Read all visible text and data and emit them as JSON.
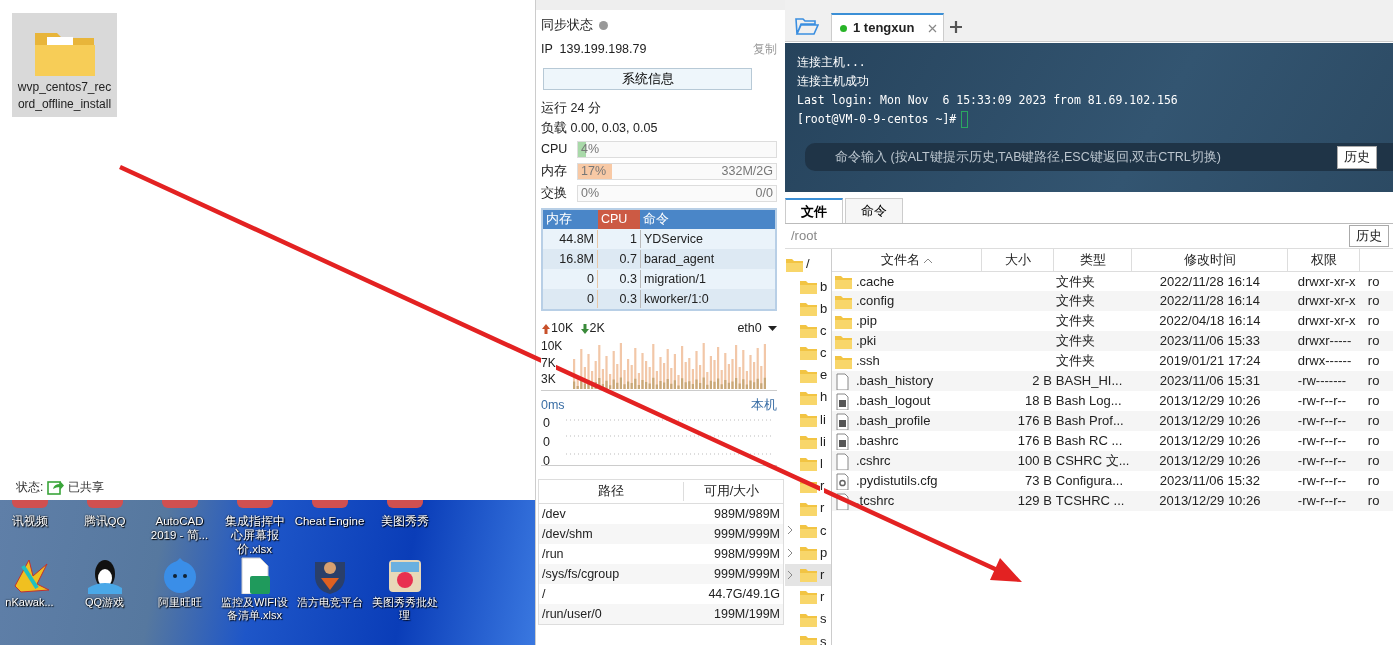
{
  "explorer_window": {
    "folder": {
      "label": "wvp_centos7_record_offline_install",
      "selected": true
    },
    "status_label": "状态:",
    "status_value": "已共享"
  },
  "desktop_icons_top": [
    {
      "label": "讯视频"
    },
    {
      "label": "腾讯QQ"
    },
    {
      "label": "AutoCAD 2019 - 简..."
    },
    {
      "label": "集成指挥中心屏幕报价.xlsx"
    },
    {
      "label": "Cheat Engine"
    },
    {
      "label": "美图秀秀"
    }
  ],
  "desktop_icons_bottom": [
    {
      "label": "nKawak...",
      "kind": "game"
    },
    {
      "label": "QQ游戏",
      "kind": "penguin"
    },
    {
      "label": "阿里旺旺",
      "kind": "chat"
    },
    {
      "label": "监控及WIFI设备清单.xlsx",
      "kind": "sheet"
    },
    {
      "label": "浩方电竞平台",
      "kind": "shield"
    },
    {
      "label": "美图秀秀批处理",
      "kind": "photo"
    }
  ],
  "server_panel": {
    "sync_label": "同步状态",
    "synced": false,
    "ip_label": "IP",
    "ip": "139.199.198.79",
    "copy": "复制",
    "sysinfo_button": "系统信息",
    "uptime": "运行 24 分",
    "load": "负载 0.00, 0.03, 0.05",
    "meters": [
      {
        "label": "CPU",
        "value": "4%",
        "level": 0.04,
        "kind": "cpu"
      },
      {
        "label": "内存",
        "value": "17%",
        "detail": "332M/2G",
        "level": 0.17,
        "kind": "mem"
      },
      {
        "label": "交换",
        "value": "0%",
        "detail": "0/0",
        "level": 0,
        "kind": "swap"
      }
    ],
    "process_columns": [
      "内存",
      "CPU",
      "命令"
    ],
    "processes": [
      {
        "mem": "44.8M",
        "cpu": "1",
        "cmd": "YDService"
      },
      {
        "mem": "16.8M",
        "cpu": "0.7",
        "cmd": "barad_agent"
      },
      {
        "mem": "0",
        "cpu": "0.3",
        "cmd": "migration/1"
      },
      {
        "mem": "0",
        "cpu": "0.3",
        "cmd": "kworker/1:0"
      }
    ],
    "net_up": "10K",
    "net_down": "2K",
    "interface": "eth0",
    "net_ticks": [
      "10K",
      "7K",
      "3K"
    ],
    "latency": "0ms",
    "latency_host": "本机",
    "latency_ticks": [
      "0",
      "0",
      "0"
    ],
    "disk_columns": [
      "路径",
      "可用/大小"
    ],
    "disks": [
      {
        "path": "/dev",
        "usage": "989M/989M"
      },
      {
        "path": "/dev/shm",
        "usage": "999M/999M"
      },
      {
        "path": "/run",
        "usage": "998M/999M"
      },
      {
        "path": "/sys/fs/cgroup",
        "usage": "999M/999M"
      },
      {
        "path": "/",
        "usage": "44.7G/49.1G"
      },
      {
        "path": "/run/user/0",
        "usage": "199M/199M"
      }
    ]
  },
  "session_tabs": [
    {
      "label": "1 tengxun",
      "selected": true,
      "connected": true
    }
  ],
  "terminal": {
    "lines": [
      "连接主机...",
      "连接主机成功",
      "Last login: Mon Nov  6 15:33:09 2023 from 81.69.102.156",
      "[root@VM-0-9-centos ~]#"
    ],
    "command_placeholder": "命令输入 (按ALT键提示历史,TAB键路径,ESC键返回,双击CTRL切换)",
    "history_button": "历史"
  },
  "bottom_tabs": [
    {
      "label": "文件",
      "selected": true
    },
    {
      "label": "命令",
      "selected": false
    }
  ],
  "path_bar": {
    "value": "/root",
    "history_button": "历史"
  },
  "tree": [
    {
      "label": "/",
      "collapsed": false,
      "selected": false,
      "children": [
        {
          "label": "b",
          "collapsed": false,
          "selected": false
        },
        {
          "label": "b",
          "collapsed": false,
          "selected": false
        },
        {
          "label": "c",
          "collapsed": false,
          "selected": false
        },
        {
          "label": "c",
          "collapsed": false,
          "selected": false
        },
        {
          "label": "e",
          "collapsed": false,
          "selected": false
        },
        {
          "label": "h",
          "collapsed": false,
          "selected": false
        },
        {
          "label": "li",
          "collapsed": false,
          "selected": false
        },
        {
          "label": "li",
          "collapsed": false,
          "selected": false
        },
        {
          "label": "l",
          "collapsed": false,
          "selected": false
        },
        {
          "label": "r",
          "collapsed": false,
          "selected": false
        },
        {
          "label": "r",
          "collapsed": false,
          "selected": false
        },
        {
          "label": "c",
          "collapsed": true,
          "selected": false
        },
        {
          "label": "p",
          "collapsed": true,
          "selected": false
        },
        {
          "label": "r",
          "collapsed": true,
          "selected": true
        },
        {
          "label": "r",
          "collapsed": false,
          "selected": false
        },
        {
          "label": "s",
          "collapsed": false,
          "selected": false
        },
        {
          "label": "s",
          "collapsed": false,
          "selected": false
        }
      ]
    }
  ],
  "file_table": {
    "columns": [
      {
        "label": "文件名",
        "sorted": true
      },
      {
        "label": "大小",
        "sorted": false
      },
      {
        "label": "类型",
        "sorted": false
      },
      {
        "label": "修改时间",
        "sorted": false
      },
      {
        "label": "权限",
        "sorted": false
      }
    ],
    "rows": [
      {
        "kind": "folder",
        "name": ".cache",
        "size": "",
        "type": "文件夹",
        "modified": "2022/11/28 16:14",
        "perms": "drwxr-xr-x",
        "column_6": "ro"
      },
      {
        "kind": "folder",
        "name": ".config",
        "size": "",
        "type": "文件夹",
        "modified": "2022/11/28 16:14",
        "perms": "drwxr-xr-x",
        "column_6": "ro"
      },
      {
        "kind": "folder",
        "name": ".pip",
        "size": "",
        "type": "文件夹",
        "modified": "2022/04/18 16:14",
        "perms": "drwxr-xr-x",
        "column_6": "ro"
      },
      {
        "kind": "folder",
        "name": ".pki",
        "size": "",
        "type": "文件夹",
        "modified": "2023/11/06 15:33",
        "perms": "drwxr-----",
        "column_6": "ro"
      },
      {
        "kind": "folder",
        "name": ".ssh",
        "size": "",
        "type": "文件夹",
        "modified": "2019/01/21 17:24",
        "perms": "drwx------",
        "column_6": "ro"
      },
      {
        "kind": "file",
        "name": ".bash_history",
        "size": "2 B",
        "type": "BASH_HI...",
        "modified": "2023/11/06 15:31",
        "perms": "-rw-------",
        "column_6": "ro"
      },
      {
        "kind": "script",
        "name": ".bash_logout",
        "size": "18 B",
        "type": "Bash Log...",
        "modified": "2013/12/29 10:26",
        "perms": "-rw-r--r--",
        "column_6": "ro"
      },
      {
        "kind": "script",
        "name": ".bash_profile",
        "size": "176 B",
        "type": "Bash Prof...",
        "modified": "2013/12/29 10:26",
        "perms": "-rw-r--r--",
        "column_6": "ro"
      },
      {
        "kind": "script",
        "name": ".bashrc",
        "size": "176 B",
        "type": "Bash RC ...",
        "modified": "2013/12/29 10:26",
        "perms": "-rw-r--r--",
        "column_6": "ro"
      },
      {
        "kind": "file",
        "name": ".cshrc",
        "size": "100 B",
        "type": "CSHRC 文...",
        "modified": "2013/12/29 10:26",
        "perms": "-rw-r--r--",
        "column_6": "ro"
      },
      {
        "kind": "config",
        "name": ".pydistutils.cfg",
        "size": "73 B",
        "type": "Configura...",
        "modified": "2023/11/06 15:32",
        "perms": "-rw-r--r--",
        "column_6": "ro"
      },
      {
        "kind": "file",
        "name": ".tcshrc",
        "size": "129 B",
        "type": "TCSHRC ...",
        "modified": "2013/12/29 10:26",
        "perms": "-rw-r--r--",
        "column_6": "ro"
      }
    ]
  }
}
